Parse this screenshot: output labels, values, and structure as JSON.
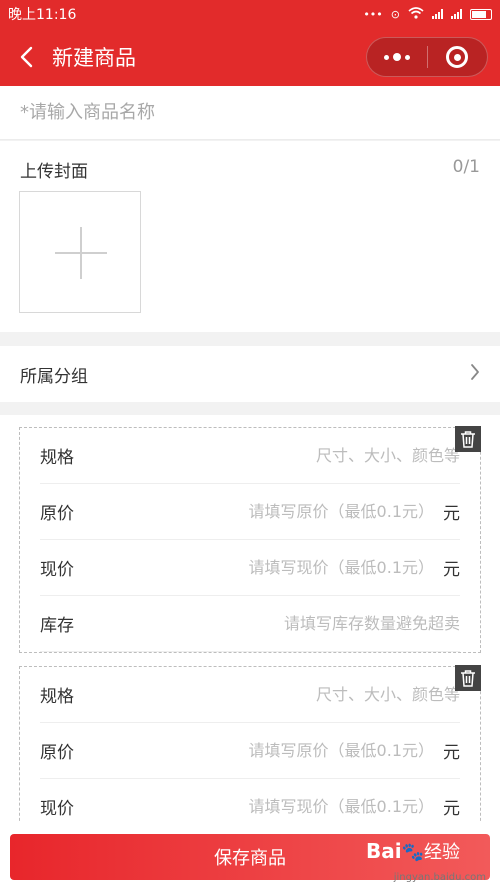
{
  "status_bar": {
    "time": "晚上11:16"
  },
  "nav": {
    "title": "新建商品"
  },
  "product": {
    "name_placeholder": "*请输入商品名称"
  },
  "cover": {
    "label": "上传封面",
    "count": "0/1"
  },
  "group": {
    "label": "所属分组"
  },
  "spec_cards": [
    {
      "spec": {
        "label": "规格",
        "placeholder": "尺寸、大小、颜色等"
      },
      "original_price": {
        "label": "原价",
        "placeholder": "请填写原价（最低0.1元）",
        "unit": "元"
      },
      "current_price": {
        "label": "现价",
        "placeholder": "请填写现价（最低0.1元）",
        "unit": "元"
      },
      "stock": {
        "label": "库存",
        "placeholder": "请填写库存数量避免超卖"
      }
    },
    {
      "spec": {
        "label": "规格",
        "placeholder": "尺寸、大小、颜色等"
      },
      "original_price": {
        "label": "原价",
        "placeholder": "请填写原价（最低0.1元）",
        "unit": "元"
      },
      "current_price": {
        "label": "现价",
        "placeholder": "请填写现价（最低0.1元）",
        "unit": "元"
      }
    }
  ],
  "save_button": {
    "label": "保存商品"
  },
  "watermark": {
    "brand": "Bai",
    "brand2": "经验",
    "url": "jingyan.baidu.com"
  },
  "icons": [
    "back-arrow-icon",
    "more-dots-icon",
    "close-target-icon",
    "plus-icon",
    "chevron-right-icon",
    "trash-icon"
  ],
  "colors": {
    "primary": "#e22b2b",
    "placeholder": "#a8a8a8",
    "divider": "#f2f2f2"
  }
}
